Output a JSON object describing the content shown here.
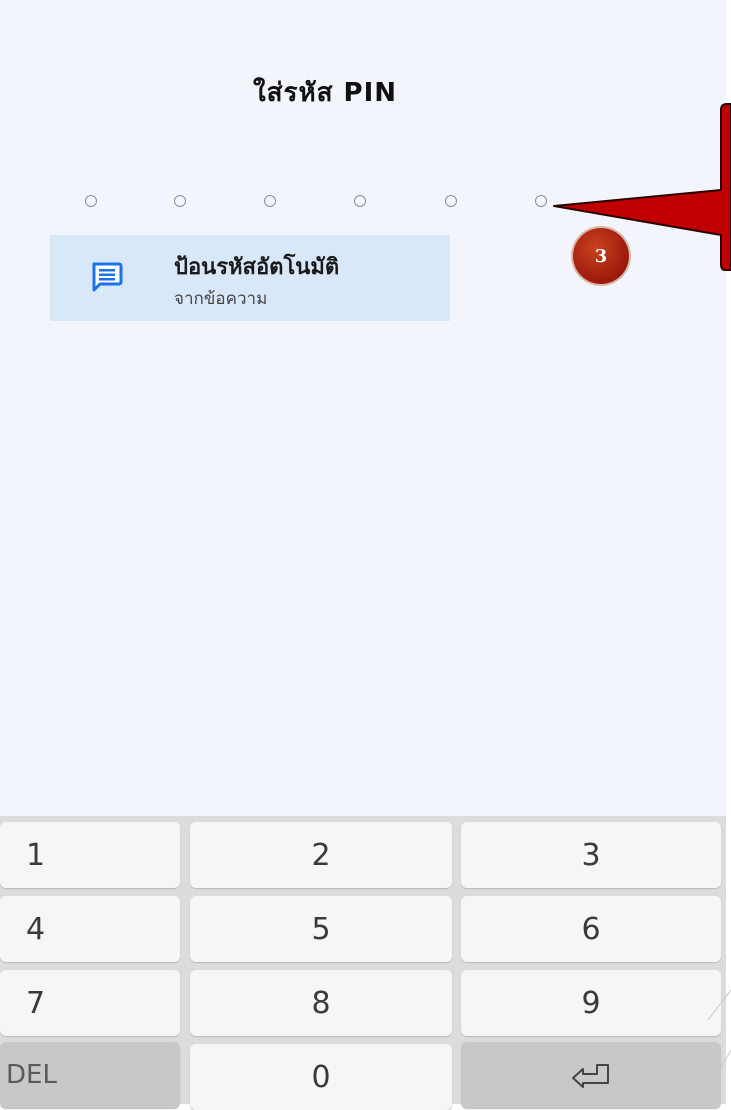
{
  "header": {
    "title": "ใส่รหัส PIN"
  },
  "pin": {
    "length": 6,
    "filled": 0
  },
  "autofill": {
    "title": "ป้อนรหัสอัตโนมัติ",
    "subtitle": "จากข้อความ",
    "icon": "message-icon",
    "background": "#d8e8f9",
    "icon_color": "#1a73e8"
  },
  "annotation": {
    "step_number": "3",
    "color": "#c00000"
  },
  "keypad": {
    "keys": {
      "k1": "1",
      "k2": "2",
      "k3": "3",
      "k4": "4",
      "k5": "5",
      "k6": "6",
      "k7": "7",
      "k8": "8",
      "k9": "9",
      "del": "DEL",
      "k0": "0",
      "enter_icon": "enter-icon"
    }
  }
}
